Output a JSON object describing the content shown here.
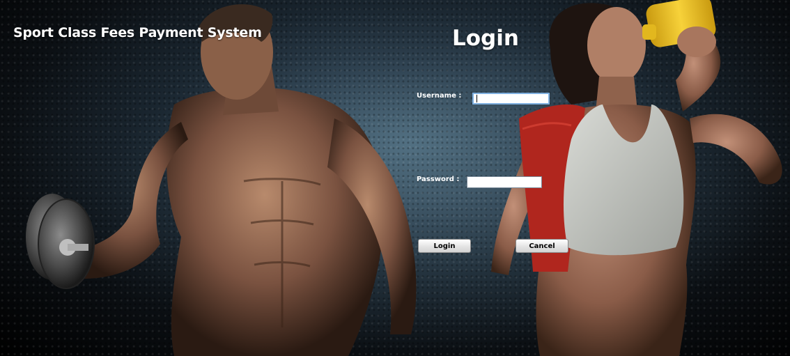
{
  "window": {
    "app_title": "Sport Class Fees Payment System"
  },
  "form": {
    "heading": "Login",
    "username_label": "Username :",
    "username_value": "",
    "password_label": "Password :",
    "password_value": "",
    "login_button": "Login",
    "cancel_button": "Cancel"
  },
  "background": {
    "left_figure": "man-lifting-dumbbell",
    "right_figure": "woman-drinking-from-shaker",
    "colors": {
      "wall": "#2e4150",
      "towel": "#b0261e",
      "shaker": "#f2c21b",
      "sports_top": "#c9ccc7"
    }
  }
}
